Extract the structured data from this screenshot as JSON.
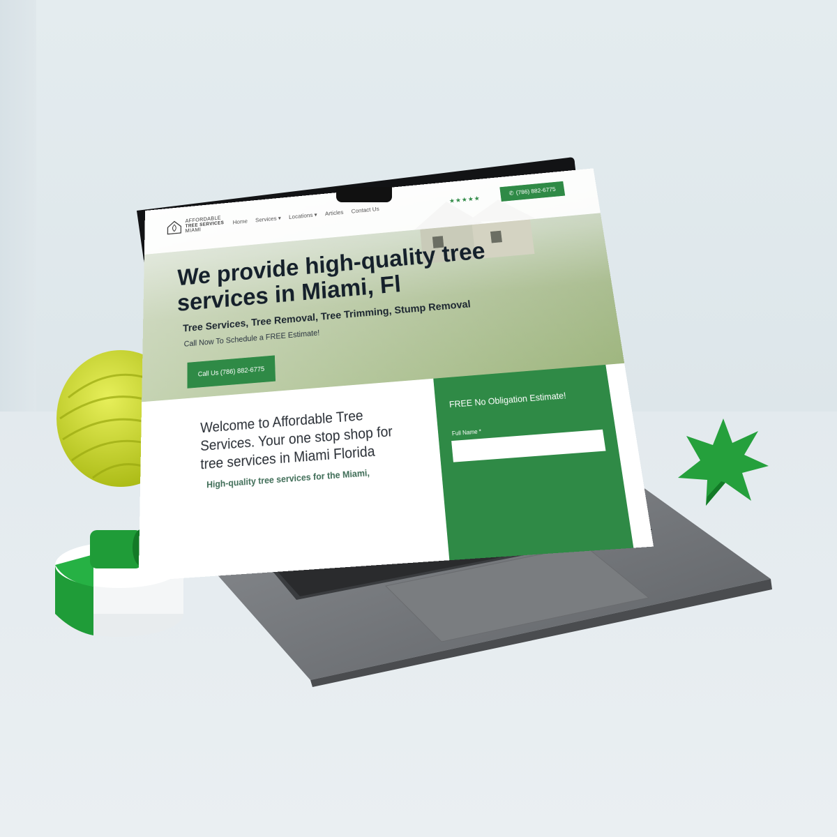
{
  "site": {
    "logo": {
      "line1": "AFFORDABLE",
      "line2": "TREE SERVICES",
      "line3": "MIAMI"
    },
    "nav": [
      "Home",
      "Services ▾",
      "Locations ▾",
      "Articles",
      "Contact Us"
    ],
    "rating_stars": "★★★★★",
    "phone_button": "(786) 882-6775",
    "hero": {
      "title": "We provide high-quality tree services in Miami, Fl",
      "subtitle": "Tree Services, Tree Removal, Tree Trimming, Stump Removal",
      "call_text": "Call Now To Schedule a FREE Estimate!",
      "button": "Call Us (786) 882-6775"
    },
    "welcome": {
      "heading": "Welcome to Affordable Tree Services. Your one stop shop for tree services in Miami Florida",
      "subheading": "High-quality tree services for the Miami,"
    },
    "form": {
      "title": "FREE No Obligation Estimate!",
      "label": "Full Name *"
    }
  },
  "colors": {
    "brand_green": "#2f8a46",
    "accent_yellow": "#c8db2e"
  }
}
